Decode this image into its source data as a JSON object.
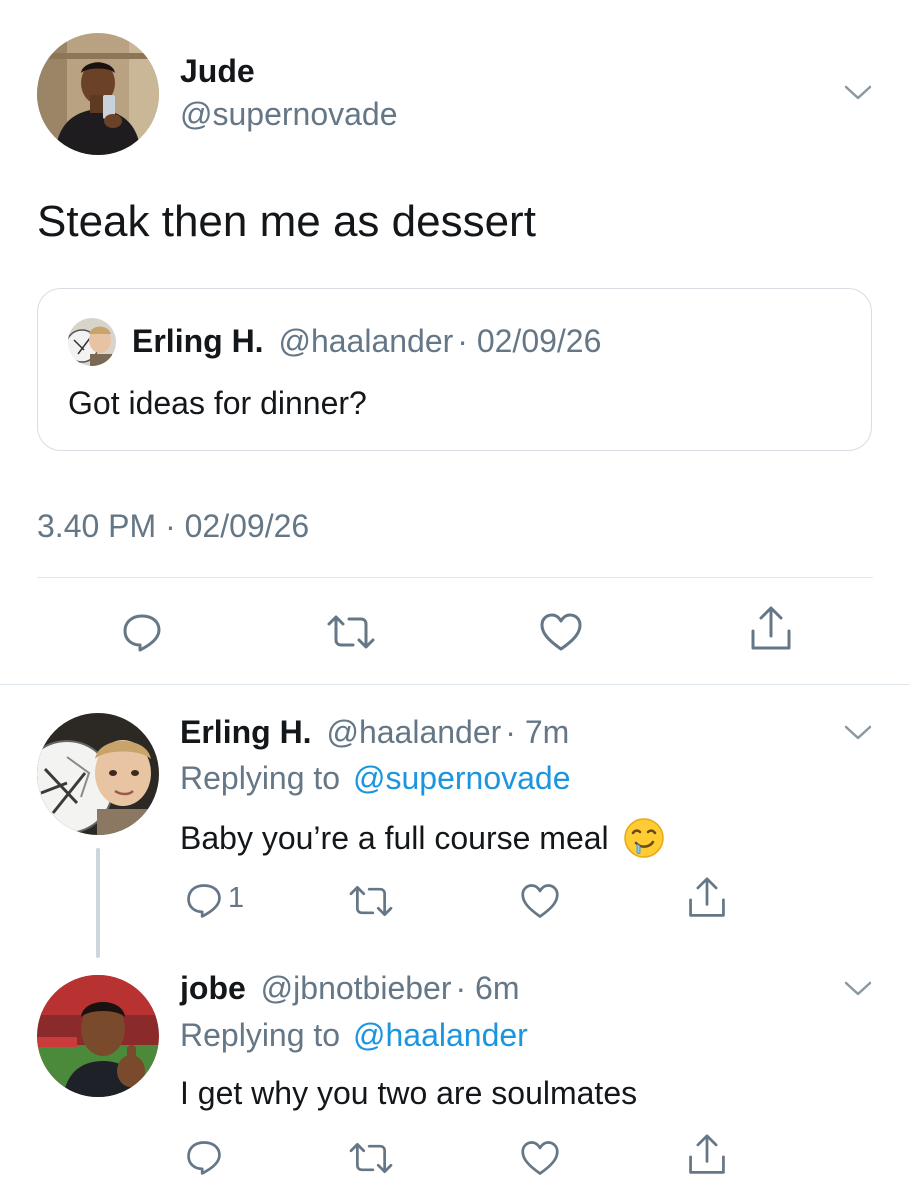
{
  "main_tweet": {
    "author_name": "Jude",
    "author_handle": "@supernovade",
    "text": "Steak then me as dessert",
    "quoted": {
      "author_name": "Erling H.",
      "author_handle": "@haalander",
      "date": "· 02/09/26",
      "text": "Got ideas for dinner?"
    },
    "timestamp": "3.40 PM · 02/09/26"
  },
  "replies": [
    {
      "author_name": "Erling H.",
      "author_handle": "@haalander",
      "time": "· 7m",
      "replying_prefix": "Replying to",
      "replying_to": "@supernovade",
      "text": "Baby you’re a full course meal",
      "reply_count": "1"
    },
    {
      "author_name": "jobe",
      "author_handle": "@jbnotbieber",
      "time": "· 6m",
      "replying_prefix": "Replying to",
      "replying_to": "@haalander",
      "text": "I get why you two are soulmates"
    }
  ],
  "icons": {
    "reply": "reply-icon",
    "retweet": "retweet-icon",
    "like": "heart-icon",
    "share": "share-icon",
    "menu": "chevron-down-icon",
    "emoji": "drooling-face-emoji"
  },
  "colors": {
    "text": "#14171a",
    "muted": "#657786",
    "link": "#1b95e0",
    "divider": "#e1e8ed"
  }
}
